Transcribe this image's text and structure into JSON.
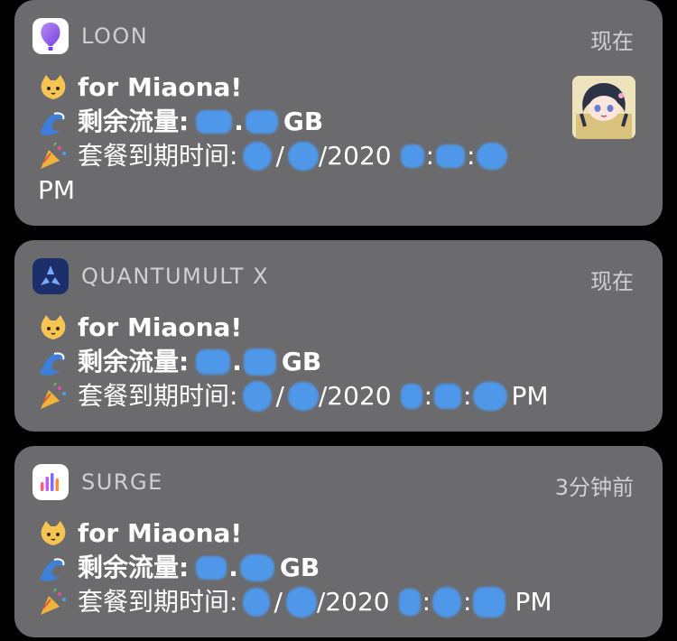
{
  "notifications": [
    {
      "app": "LOON",
      "time": "现在",
      "title": "for Miaona!",
      "traffic_label": "剩余流量:",
      "traffic_unit": "GB",
      "expire_label": "套餐到期时间:",
      "year": "/2020",
      "ampm": "PM",
      "has_thumbnail": true
    },
    {
      "app": "QUANTUMULT X",
      "time": "现在",
      "title": "for Miaona!",
      "traffic_label": "剩余流量:",
      "traffic_unit": "GB",
      "expire_label": "套餐到期时间:",
      "year": "/2020",
      "ampm": "PM"
    },
    {
      "app": "SURGE",
      "time": "3分钟前",
      "title": "for Miaona!",
      "traffic_label": "剩余流量:",
      "traffic_unit": "GB",
      "expire_label": "套餐到期时间:",
      "year": "/2020",
      "ampm": "PM"
    }
  ],
  "icons": {
    "loon": "hot-air-balloon-icon",
    "quantumult": "quantumult-logo-icon",
    "surge": "surge-logo-icon",
    "cat": "cat-face-emoji",
    "wave": "water-wave-emoji",
    "party": "party-popper-emoji"
  },
  "colors": {
    "card_bg": "#6b6b6e",
    "redaction_blue": "#4f97e8",
    "page_bg": "#000000"
  }
}
